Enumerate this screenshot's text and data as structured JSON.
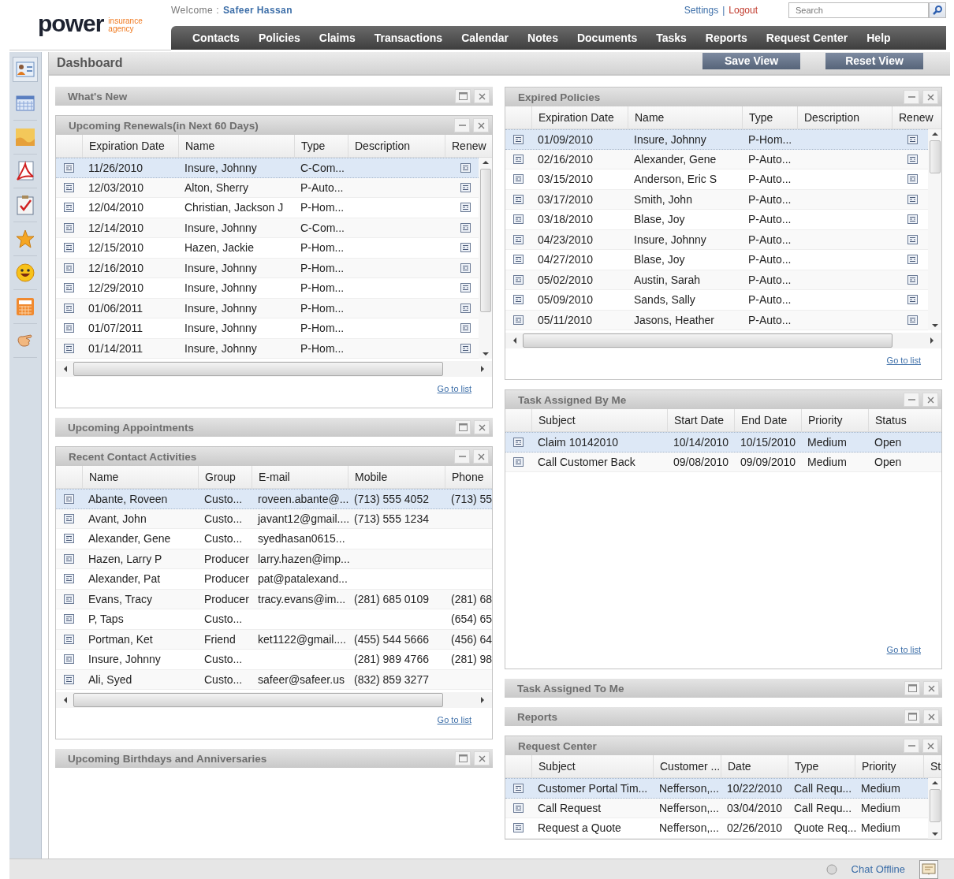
{
  "logo": {
    "name": "power",
    "tagline": [
      "insurance",
      "agency"
    ]
  },
  "top": {
    "welcome": "Welcome :",
    "user": "Safeer Hassan",
    "settings": "Settings",
    "separator": "|",
    "logout": "Logout",
    "search": {
      "placeholder": "Search"
    }
  },
  "nav": [
    "Contacts",
    "Policies",
    "Claims",
    "Transactions",
    "Calendar",
    "Notes",
    "Documents",
    "Tasks",
    "Reports",
    "Request Center",
    "Help"
  ],
  "dashboard": {
    "title": "Dashboard",
    "buttons": [
      "Save View",
      "Reset View"
    ]
  },
  "columns": [
    [
      {
        "title": "What's New",
        "collapsed": true
      },
      {
        "title": "Upcoming Renewals(in Next 60 Days)",
        "collapsed": false,
        "link": "Go to list",
        "table": {
          "columns": [
            {
              "label": "Expiration Date",
              "kind": "text"
            },
            {
              "label": "Name",
              "kind": "text"
            },
            {
              "label": "Type",
              "kind": "text"
            },
            {
              "label": "Description",
              "kind": "text"
            },
            {
              "label": "Renew",
              "kind": "icon"
            }
          ],
          "rows": [
            {
              "selected": true,
              "cells": [
                "11/26/2010",
                "Insure, Johnny",
                "C-Com...",
                null,
                null
              ]
            },
            {
              "selected": false,
              "cells": [
                "12/03/2010",
                "Alton, Sherry",
                "P-Auto...",
                null,
                null
              ]
            },
            {
              "selected": false,
              "cells": [
                "12/04/2010",
                "Christian, Jackson J",
                "P-Hom...",
                null,
                null
              ]
            },
            {
              "selected": false,
              "cells": [
                "12/14/2010",
                "Insure, Johnny",
                "C-Com...",
                null,
                null
              ]
            },
            {
              "selected": false,
              "cells": [
                "12/15/2010",
                "Hazen, Jackie",
                "P-Hom...",
                null,
                null
              ]
            },
            {
              "selected": false,
              "cells": [
                "12/16/2010",
                "Insure, Johnny",
                "P-Hom...",
                null,
                null
              ]
            },
            {
              "selected": false,
              "cells": [
                "12/29/2010",
                "Insure, Johnny",
                "P-Hom...",
                null,
                null
              ]
            },
            {
              "selected": false,
              "cells": [
                "01/06/2011",
                "Insure, Johnny",
                "P-Hom...",
                null,
                null
              ]
            },
            {
              "selected": false,
              "cells": [
                "01/07/2011",
                "Insure, Johnny",
                "P-Hom...",
                null,
                null
              ]
            },
            {
              "selected": false,
              "cells": [
                "01/14/2011",
                "Insure, Johnny",
                "P-Hom...",
                null,
                null
              ]
            }
          ]
        }
      },
      {
        "title": "Upcoming Appointments",
        "collapsed": true
      },
      {
        "title": "Recent Contact Activities",
        "collapsed": false,
        "link": "Go to list",
        "table": {
          "columns": [
            {
              "label": "Name",
              "kind": "text"
            },
            {
              "label": "Group",
              "kind": "text"
            },
            {
              "label": "E-mail",
              "kind": "text"
            },
            {
              "label": "Mobile",
              "kind": "text"
            },
            {
              "label": "Phone",
              "kind": "text"
            }
          ],
          "rows": [
            {
              "selected": true,
              "cells": [
                "Abante, Roveen",
                "Custo...",
                "roveen.abante@...",
                "(713) 555 4052",
                "(713) 55"
              ]
            },
            {
              "selected": false,
              "cells": [
                "Avant, John",
                "Custo...",
                "javant12@gmail....",
                "(713) 555 1234",
                null
              ]
            },
            {
              "selected": false,
              "cells": [
                "Alexander, Gene",
                "Custo...",
                "syedhasan0615...",
                null,
                null
              ]
            },
            {
              "selected": false,
              "cells": [
                "Hazen, Larry P",
                "Producer",
                "larry.hazen@imp...",
                null,
                null
              ]
            },
            {
              "selected": false,
              "cells": [
                "Alexander, Pat",
                "Producer",
                "pat@patalexand...",
                null,
                null
              ]
            },
            {
              "selected": false,
              "cells": [
                "Evans, Tracy",
                "Producer",
                "tracy.evans@im...",
                "(281) 685 0109",
                "(281) 68"
              ]
            },
            {
              "selected": false,
              "cells": [
                "P, Taps",
                "Custo...",
                null,
                null,
                "(654) 65"
              ]
            },
            {
              "selected": false,
              "cells": [
                "Portman, Ket",
                "Friend",
                "ket1122@gmail....",
                "(455) 544 5666",
                "(456) 64"
              ]
            },
            {
              "selected": false,
              "cells": [
                "Insure, Johnny",
                "Custo...",
                null,
                "(281) 989 4766",
                "(281) 98"
              ]
            },
            {
              "selected": false,
              "cells": [
                "Ali, Syed",
                "Custo...",
                "safeer@safeer.us",
                "(832) 859 3277",
                null
              ]
            }
          ]
        }
      },
      {
        "title": "Upcoming Birthdays and Anniversaries",
        "collapsed": true
      }
    ],
    [
      {
        "title": "Expired Policies",
        "collapsed": false,
        "link": "Go to list",
        "table": {
          "columns": [
            {
              "label": "Expiration Date",
              "kind": "text"
            },
            {
              "label": "Name",
              "kind": "text"
            },
            {
              "label": "Type",
              "kind": "text"
            },
            {
              "label": "Description",
              "kind": "text"
            },
            {
              "label": "Renew",
              "kind": "icon"
            }
          ],
          "rows": [
            {
              "selected": true,
              "cells": [
                "01/09/2010",
                "Insure, Johnny",
                "P-Hom...",
                null,
                null
              ]
            },
            {
              "selected": false,
              "cells": [
                "02/16/2010",
                "Alexander, Gene",
                "P-Auto...",
                null,
                null
              ]
            },
            {
              "selected": false,
              "cells": [
                "03/15/2010",
                "Anderson, Eric S",
                "P-Auto...",
                null,
                null
              ]
            },
            {
              "selected": false,
              "cells": [
                "03/17/2010",
                "Smith, John",
                "P-Auto...",
                null,
                null
              ]
            },
            {
              "selected": false,
              "cells": [
                "03/18/2010",
                "Blase, Joy",
                "P-Auto...",
                null,
                null
              ]
            },
            {
              "selected": false,
              "cells": [
                "04/23/2010",
                "Insure, Johnny",
                "P-Auto...",
                null,
                null
              ]
            },
            {
              "selected": false,
              "cells": [
                "04/27/2010",
                "Blase, Joy",
                "P-Auto...",
                null,
                null
              ]
            },
            {
              "selected": false,
              "cells": [
                "05/02/2010",
                "Austin, Sarah",
                "P-Auto...",
                null,
                null
              ]
            },
            {
              "selected": false,
              "cells": [
                "05/09/2010",
                "Sands, Sally",
                "P-Auto...",
                null,
                null
              ]
            },
            {
              "selected": false,
              "cells": [
                "05/11/2010",
                "Jasons, Heather",
                "P-Auto...",
                null,
                null
              ]
            }
          ]
        }
      },
      {
        "title": "Task Assigned By Me",
        "collapsed": false,
        "link": "Go to list",
        "table": {
          "columns": [
            {
              "label": "Subject",
              "kind": "text"
            },
            {
              "label": "Start Date",
              "kind": "text"
            },
            {
              "label": "End Date",
              "kind": "text"
            },
            {
              "label": "Priority",
              "kind": "text"
            },
            {
              "label": "Status",
              "kind": "text"
            }
          ],
          "rows": [
            {
              "selected": true,
              "cells": [
                "Claim 10142010",
                "10/14/2010",
                "10/15/2010",
                "Medium",
                "Open"
              ]
            },
            {
              "selected": false,
              "cells": [
                "Call Customer Back",
                "09/08/2010",
                "09/09/2010",
                "Medium",
                "Open"
              ]
            }
          ]
        }
      },
      {
        "title": "Task Assigned To Me",
        "collapsed": true
      },
      {
        "title": "Reports",
        "collapsed": true
      },
      {
        "title": "Request Center",
        "collapsed": false,
        "table": {
          "columns": [
            {
              "label": "Subject",
              "kind": "text"
            },
            {
              "label": "Customer ...",
              "kind": "text"
            },
            {
              "label": "Date",
              "kind": "text"
            },
            {
              "label": "Type",
              "kind": "text"
            },
            {
              "label": "Priority",
              "kind": "text"
            },
            {
              "label": "St",
              "kind": "text"
            }
          ],
          "rows": [
            {
              "selected": true,
              "cells": [
                "Customer Portal Tim...",
                "Nefferson,...",
                "10/22/2010",
                "Call Requ...",
                "Medium",
                null
              ]
            },
            {
              "selected": false,
              "cells": [
                "Call Request",
                "Nefferson,...",
                "03/04/2010",
                "Call Requ...",
                "Medium",
                null
              ]
            },
            {
              "selected": false,
              "cells": [
                "Request a Quote",
                "Nefferson,...",
                "02/26/2010",
                "Quote Req...",
                "Medium",
                null
              ]
            }
          ]
        }
      }
    ]
  ],
  "status_bar": {
    "chat": "Chat Offline"
  }
}
